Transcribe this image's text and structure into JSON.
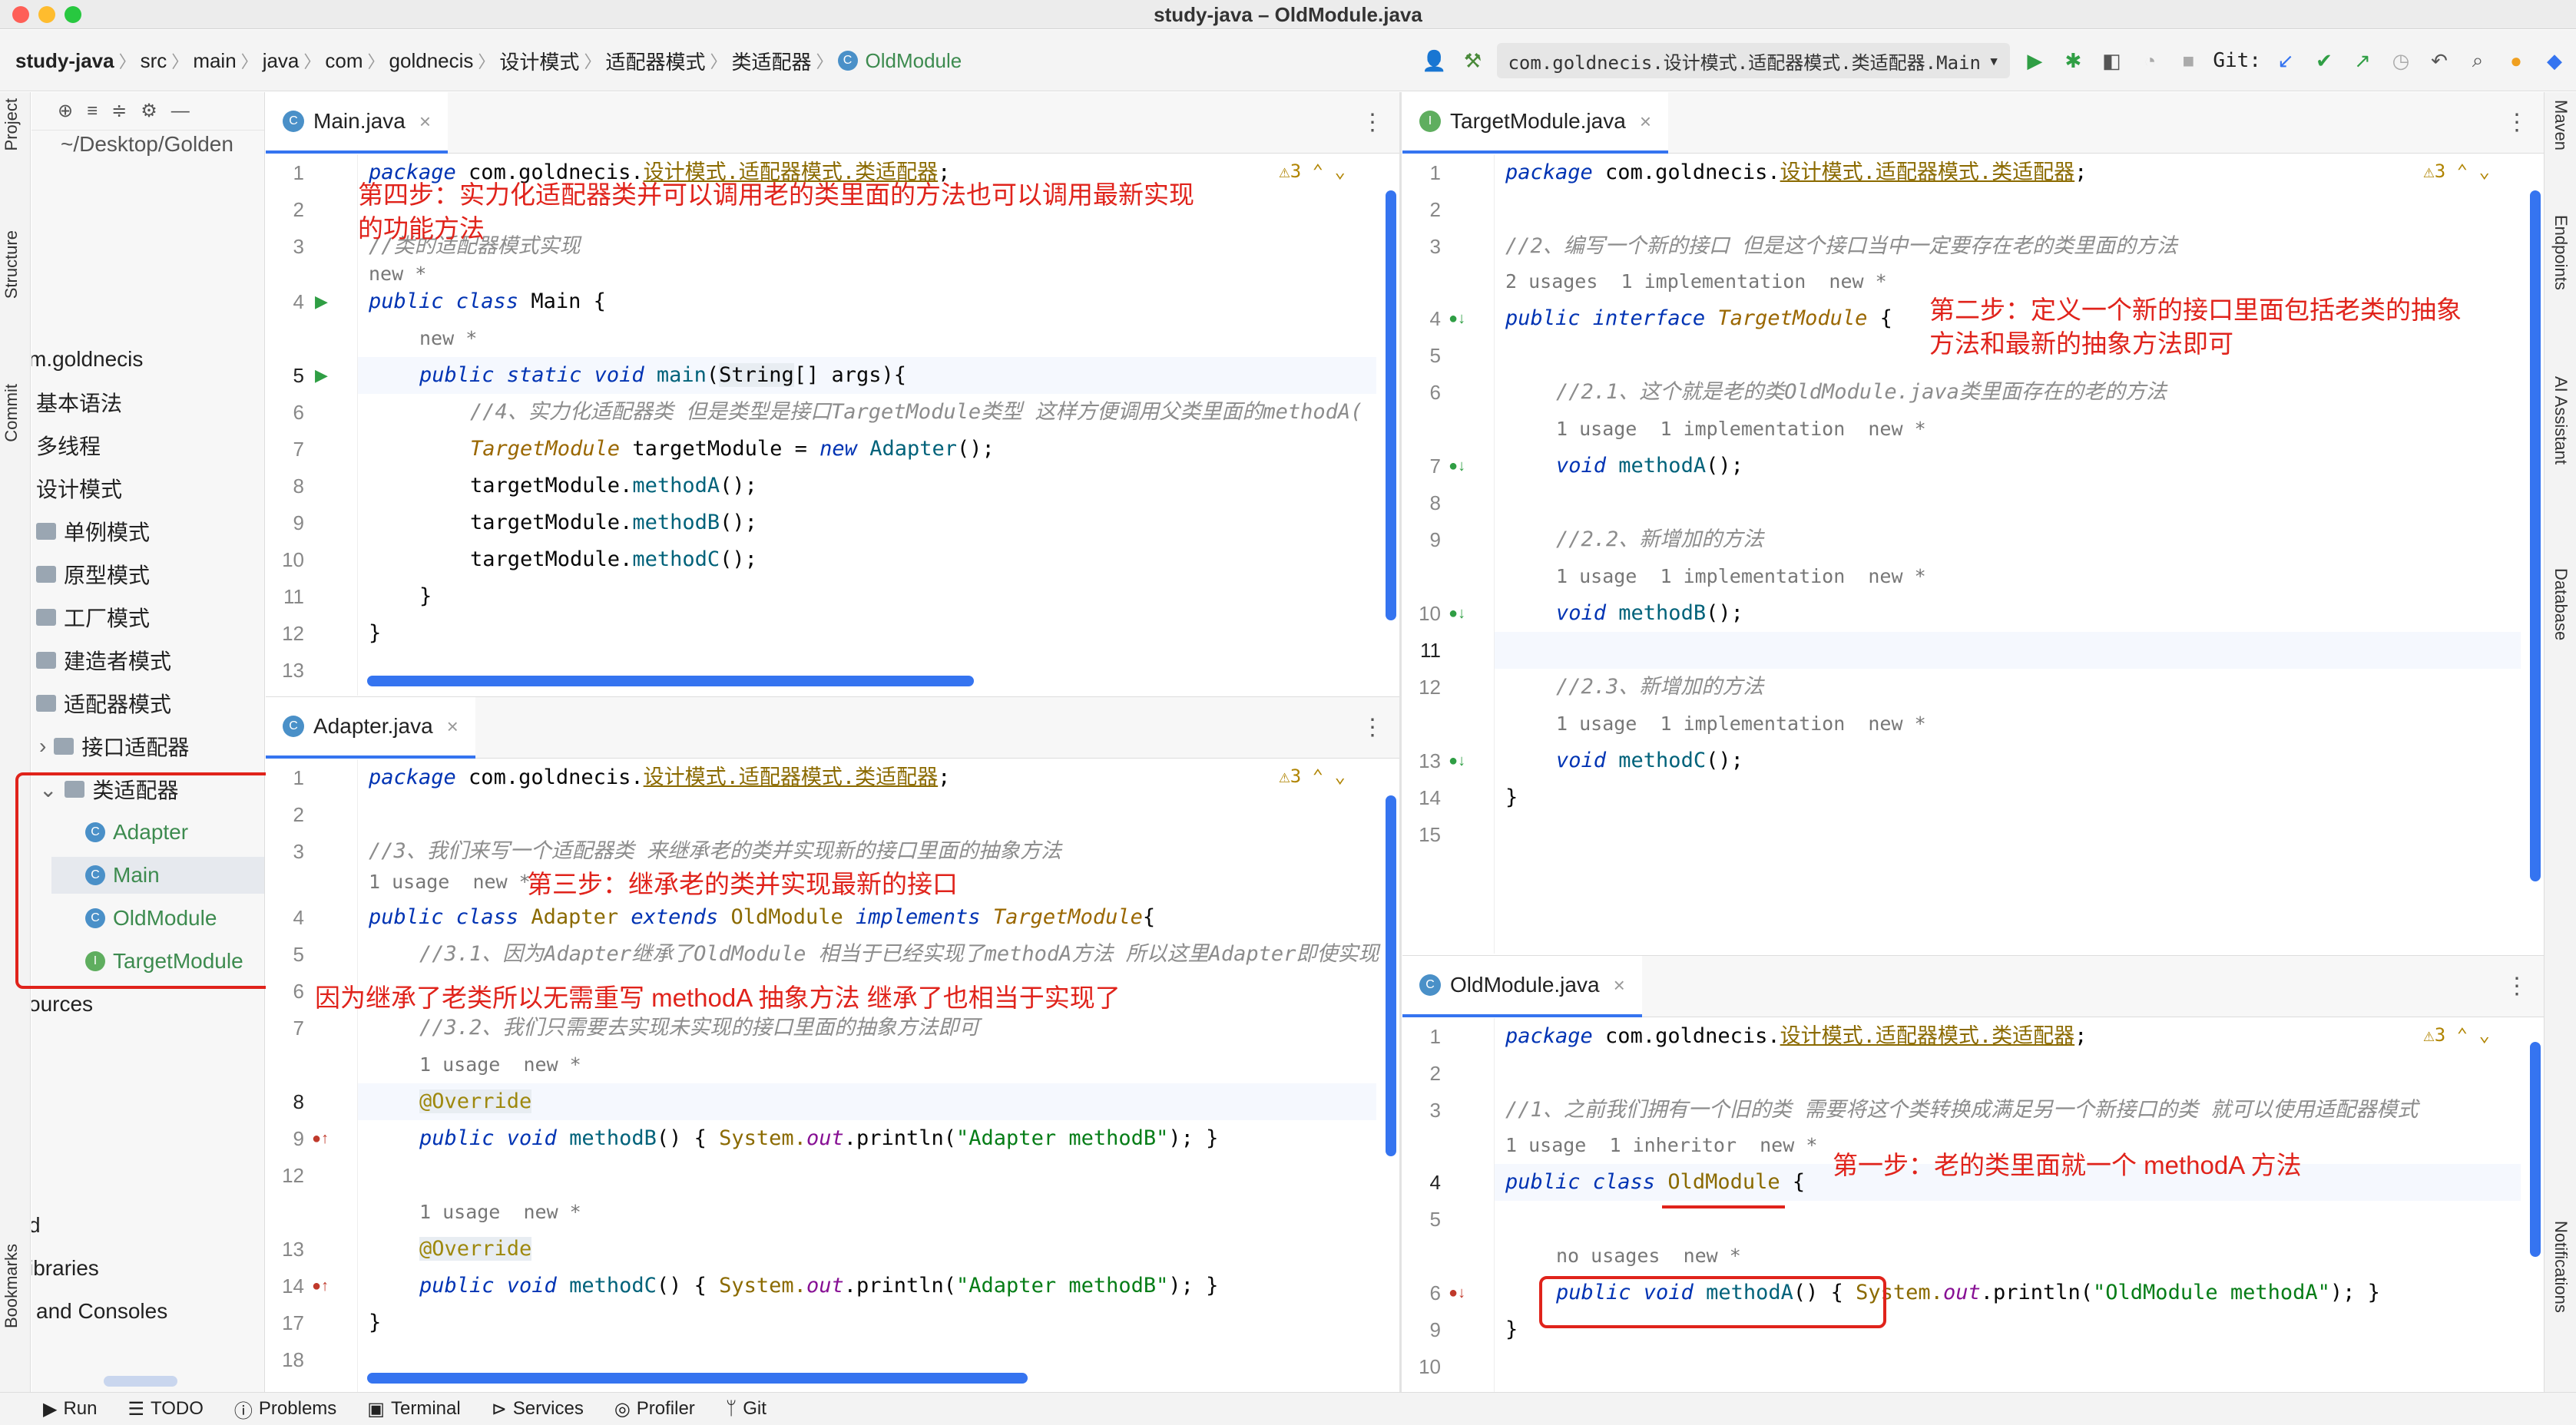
{
  "window": {
    "title": "study-java – OldModule.java"
  },
  "breadcrumbs": [
    "study-java",
    "src",
    "main",
    "java",
    "com",
    "goldnecis",
    "设计模式",
    "适配器模式",
    "类适配器",
    "OldModule"
  ],
  "toolbar": {
    "run_config": "com.goldnecis.设计模式.适配器模式.类适配器.Main",
    "git_label": "Git:"
  },
  "left_strip": {
    "project": "Project",
    "structure": "Structure",
    "commit": "Commit",
    "bookmarks": "Bookmarks"
  },
  "right_strip": {
    "maven": "Maven",
    "endpoints": "Endpoints",
    "ai": "AI Assistant",
    "database": "Database",
    "notifications": "Notifications"
  },
  "project": {
    "path": "~/Desktop/Golden",
    "items": [
      "m.goldnecis",
      "基本语法",
      "多线程",
      "设计模式",
      "单例模式",
      "原型模式",
      "工厂模式",
      "建造者模式",
      "适配器模式",
      "接口适配器",
      "类适配器",
      "Adapter",
      "Main",
      "OldModule",
      "TargetModule",
      "ources",
      "d",
      "ibraries",
      "and Consoles"
    ]
  },
  "editors": {
    "main": {
      "tab": "Main.java",
      "warn": "3",
      "lines": [
        "1",
        "2",
        "3",
        "4",
        "5",
        "6",
        "7",
        "8",
        "9",
        "10",
        "11",
        "12",
        "13"
      ],
      "code": {
        "l1_kw": "package",
        "l1_rest": " com.goldnecis.",
        "l1_pkg": "设计模式.适配器模式.类适配器",
        ";": ";",
        "l3": "//类的适配器模式实现",
        "hint_new": "new *",
        "l4_a": "public class",
        "l4_b": " Main {",
        "hint_new2": "new *",
        "l5_a": "public static void",
        "l5_b": "main",
        "l5_c": "(",
        "l5_d": "String",
        "l5_e": "[] args){",
        "l6": "//4、实力化适配器类 但是类型是接口TargetModule类型 这样方便调用父类里面的methodA(",
        "l7_a": "TargetModule",
        "l7_b": " targetModule = ",
        "l7_c": "new",
        "l7_d": " Adapter",
        "l7_e": "();",
        "l8_a": "targetModule.",
        "l8_b": "methodA",
        "l8_c": "();",
        "l9_b": "methodB",
        "l10_b": "methodC",
        "l11": "}",
        "l12": "}"
      }
    },
    "adapter": {
      "tab": "Adapter.java",
      "warn": "3",
      "lines": [
        "1",
        "2",
        "3",
        "",
        "4",
        "5",
        "6",
        "7",
        "",
        "8",
        "9",
        "12",
        "",
        "13",
        "14",
        "17",
        "18"
      ],
      "code": {
        "l3": "//3、我们来写一个适配器类 来继承老的类并实现新的接口里面的抽象方法",
        "hint1": "1 usage  new *",
        "l4_a": "public class",
        "l4_b": " Adapter ",
        "l4_c": "extends",
        "l4_d": " OldModule ",
        "l4_e": "implements",
        "l4_f": " TargetModule",
        "l4_g": "{",
        "l5": "//3.1、因为Adapter继承了OldModule 相当于已经实现了methodA方法 所以这里Adapter即使实现",
        "l7": "//3.2、我们只需要去实现未实现的接口里面的抽象方法即可",
        "hint2": "1 usage  new *",
        "ann": "@Override",
        "l9_a": "public void",
        "l9_b": " methodB",
        "l9_c": "() { ",
        "l9_d": "System.",
        "l9_e": "out",
        "l9_f": ".println(",
        "l9_g": "\"Adapter methodB\"",
        "l9_h": "); }",
        "l14_b": " methodC",
        "l17": "}"
      }
    },
    "target": {
      "tab": "TargetModule.java",
      "warn": "3",
      "lines": [
        "1",
        "2",
        "3",
        "",
        "4",
        "5",
        "6",
        "",
        "7",
        "8",
        "9",
        "",
        "10",
        "11",
        "12",
        "",
        "13",
        "14",
        "15"
      ],
      "code": {
        "l3": "//2、编写一个新的接口 但是这个接口当中一定要存在老的类里面的方法",
        "hint1": "2 usages  1 implementation  new *",
        "l4_a": "public interface",
        "l4_b": " TargetModule",
        "l4_c": " {",
        "l6": "//2.1、这个就是老的类OldModule.java类里面存在的老的方法",
        "hint2": "1 usage  1 implementation  new *",
        "l7_a": "void",
        "l7_b": " methodA",
        "l7_c": "();",
        "l9": "//2.2、新增加的方法",
        "l10_b": " methodB",
        "l12": "//2.3、新增加的方法",
        "l13_b": " methodC",
        "l14": "}"
      }
    },
    "old": {
      "tab": "OldModule.java",
      "warn": "3",
      "lines": [
        "1",
        "2",
        "3",
        "",
        "4",
        "5",
        "",
        "6",
        "9",
        "10"
      ],
      "code": {
        "l3": "//1、之前我们拥有一个旧的类 需要将这个类转换成满足另一个新接口的类 就可以使用适配器模式",
        "hint1": "1 usage  1 inheritor  new *",
        "l4_a": "public class",
        "l4_b": " OldModule",
        "l4_c": " {",
        "hint2": "no usages  new *",
        "l6_a": "public void",
        "l6_b": " methodA",
        "l6_c": "() { ",
        "l6_d": "System.",
        "l6_e": "out",
        "l6_f": ".println(",
        "l6_g": "\"OldModule methodA\"",
        "l6_h": "); }",
        "l9": "}"
      }
    }
  },
  "annotations": {
    "step4": "第四步：实力化适配器类并可以调用老的类里面的方法也可以调用最新实现",
    "step4b": "的功能方法",
    "step2": "第二步：定义一个新的接口里面包括老类的抽象",
    "step2b": "方法和最新的抽象方法即可",
    "step3": "第三步：继承老的类并实现最新的接口",
    "reason": "因为继承了老类所以无需重写 methodA 抽象方法 继承了也相当于实现了",
    "step1": "第一步：老的类里面就一个 methodA 方法"
  },
  "statusbar": [
    "Run",
    "TODO",
    "Problems",
    "Terminal",
    "Services",
    "Profiler",
    "Git"
  ],
  "colors": {
    "accent": "#3574f0",
    "annotation_red": "#e0231b",
    "keyword": "#0033b3",
    "string": "#067d17"
  }
}
